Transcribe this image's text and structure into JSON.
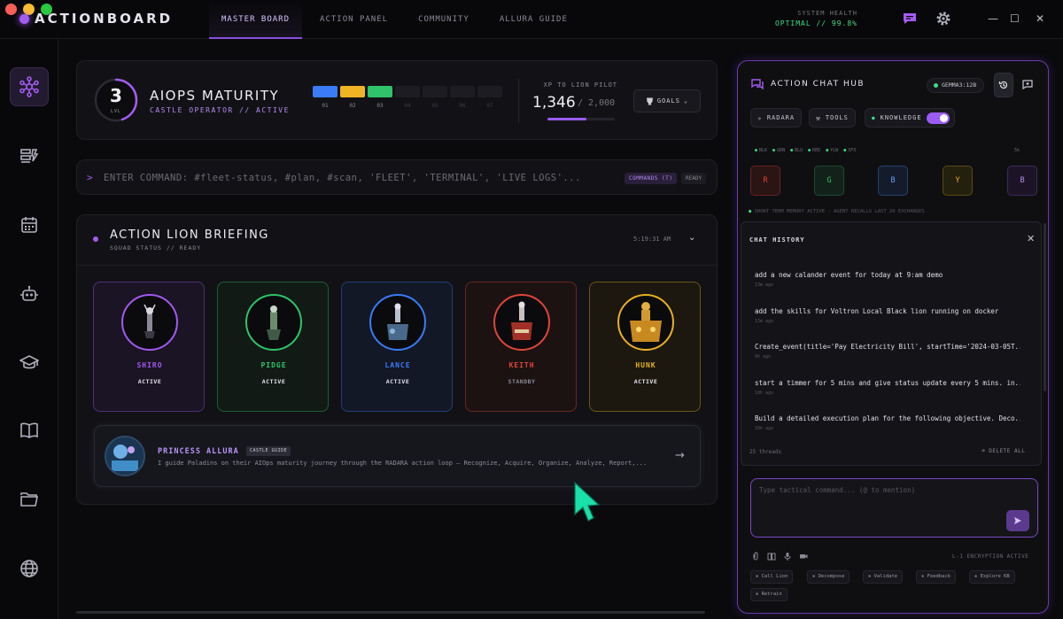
{
  "app": {
    "brand": "ACTIONBOARD",
    "window_dots": [
      "#ff5f57",
      "#febc2e",
      "#28c840"
    ]
  },
  "nav": {
    "tabs": [
      {
        "label": "MASTER BOARD",
        "active": true
      },
      {
        "label": "ACTION PANEL",
        "active": false
      },
      {
        "label": "COMMUNITY",
        "active": false
      },
      {
        "label": "ALLURA GUIDE",
        "active": false
      }
    ]
  },
  "system": {
    "health_label": "SYSTEM HEALTH",
    "health_value": "OPTIMAL // 99.8%"
  },
  "window_controls": {
    "minimize": "—",
    "maximize": "☐",
    "close": "✕"
  },
  "sidebar": {
    "items": [
      {
        "icon": "network-icon",
        "active": true
      },
      {
        "icon": "tasks-icon",
        "active": false
      },
      {
        "icon": "calendar-icon",
        "active": false
      },
      {
        "icon": "robot-icon",
        "active": false
      },
      {
        "icon": "graduation-cap-icon",
        "active": false
      },
      {
        "icon": "book-icon",
        "active": false
      },
      {
        "icon": "folder-icon",
        "active": false
      },
      {
        "icon": "globe-icon",
        "active": false
      }
    ]
  },
  "maturity": {
    "level": "3",
    "level_label": "LVL",
    "level_progress": 0.45,
    "title": "AIOPS MATURITY",
    "subtitle": "CASTLE OPERATOR // ACTIVE",
    "steps": [
      {
        "label": "01",
        "color": "#3b7bf5",
        "done": true
      },
      {
        "label": "02",
        "color": "#f0b323",
        "done": true
      },
      {
        "label": "03",
        "color": "#2fc46a",
        "done": true
      },
      {
        "label": "04",
        "color": "#1c1c22",
        "done": false
      },
      {
        "label": "05",
        "color": "#1c1c22",
        "done": false
      },
      {
        "label": "06",
        "color": "#1c1c22",
        "done": false
      },
      {
        "label": "07",
        "color": "#1c1c22",
        "done": false
      }
    ],
    "xp_label": "XP TO LION PILOT",
    "xp_value": "1,346",
    "xp_max": "/ 2,000",
    "xp_fraction": 0.573,
    "goals_label": "GOALS"
  },
  "command": {
    "prompt": ">",
    "placeholder": "ENTER COMMAND: #fleet-status, #plan, #scan, 'FLEET', 'TERMINAL', 'LIVE LOGS'...",
    "commands_badge": "COMMANDS (T)",
    "status": "READY"
  },
  "briefing": {
    "title": "ACTION LION BRIEFING",
    "subtitle": "SQUAD STATUS // READY",
    "time": "5:19:31 AM",
    "paladins": [
      {
        "name": "SHIRO",
        "status": "ACTIVE",
        "color": "#a259f0",
        "bg": "#1a1424"
      },
      {
        "name": "PIDGE",
        "status": "ACTIVE",
        "color": "#2fc46a",
        "bg": "#121a15"
      },
      {
        "name": "LANCE",
        "status": "ACTIVE",
        "color": "#3b7bf5",
        "bg": "#121826"
      },
      {
        "name": "KEITH",
        "status": "STANDBY",
        "color": "#e0453a",
        "bg": "#1c1212"
      },
      {
        "name": "HUNK",
        "status": "ACTIVE",
        "color": "#e8b020",
        "bg": "#1c1810"
      }
    ],
    "guide": {
      "name": "PRINCESS ALLURA",
      "badge": "CASTLE GUIDE",
      "description": "I guide Paladins on their AIOps maturity journey through the RADARA action loop — Recognize, Acquire, Organize, Analyze, Report,..."
    }
  },
  "chat": {
    "title": "ACTION CHAT HUB",
    "model": "GEMMA3:12B",
    "pills": {
      "radara": "RADARA",
      "tools": "TOOLS",
      "knowledge": "KNOWLEDGE"
    },
    "knowledge_on": true,
    "legend": [
      "BLK",
      "GRN",
      "BLU",
      "RED",
      "YLW",
      "SFX"
    ],
    "legend_right": "5k",
    "lions": [
      {
        "letter": "R",
        "color": "#e0453a",
        "bg": "#2a1414",
        "border": "#6a2222"
      },
      {
        "letter": "G",
        "color": "#2fc46a",
        "bg": "#12221a",
        "border": "#1e4a30"
      },
      {
        "letter": "B",
        "color": "#6a9cf8",
        "bg": "#141c2c",
        "border": "#25406e"
      },
      {
        "letter": "Y",
        "color": "#e8b020",
        "bg": "#24200e",
        "border": "#5a4a14"
      },
      {
        "letter": "B",
        "color": "#b48ff0",
        "bg": "#1c1426",
        "border": "#3d2a5a"
      }
    ],
    "memory": "SHORT TERM MEMORY ACTIVE · AGENT RECALLS LAST 20 EXCHANGES",
    "history_title": "CHAT HISTORY",
    "history": [
      {
        "text": "add a new calander event for today at 9:am demo",
        "time": "13m ago"
      },
      {
        "text": "add the skills for Voltron Local Black lion running on docker",
        "time": "13m ago"
      },
      {
        "text": "Create_event(title='Pay Electricity Bill', startTime='2024-03-05T...",
        "time": "9h ago"
      },
      {
        "text": "start a timmer for 5 mins and give status update every 5 mins. in...",
        "time": "10h ago"
      },
      {
        "text": "Build a detailed execution plan for the following objective. Deco...",
        "time": "10h ago"
      }
    ],
    "threads": "25 threads",
    "delete_all": "DELETE ALL",
    "composer_placeholder": "Type tactical command... (@ to mention)",
    "encryption": "L-1 ENCRYPTION ACTIVE",
    "chips": [
      "Call Lion",
      "Decompose",
      "Validate",
      "Feedback",
      "Explore KB",
      "Retrain"
    ]
  }
}
